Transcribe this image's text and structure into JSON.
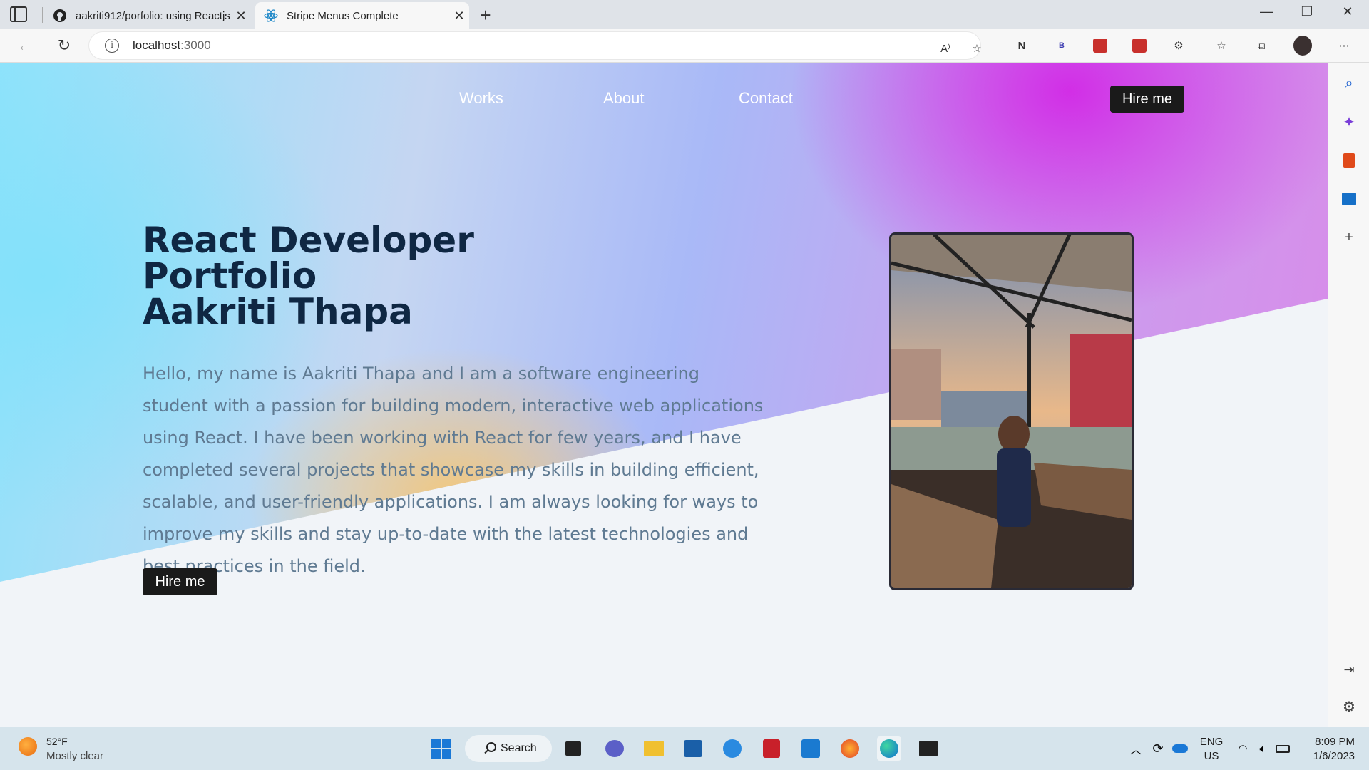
{
  "browser": {
    "tabs": [
      {
        "title": "aakriti912/porfolio: using Reactjs",
        "active": false,
        "icon": "github-icon"
      },
      {
        "title": "Stripe Menus Complete",
        "active": true,
        "icon": "react-icon"
      }
    ],
    "address": {
      "host": "localhost",
      "port": ":3000"
    }
  },
  "page": {
    "nav": {
      "links": [
        "Works",
        "About",
        "Contact"
      ],
      "cta": "Hire me"
    },
    "hero": {
      "title_lines": [
        "React Developer",
        "Portfolio",
        "Aakriti Thapa"
      ],
      "paragraph": "Hello, my name is Aakriti Thapa and I am a software engineering student with a passion for building modern, interactive web applications using React. I have been working with React for few years, and I have completed several projects that showcase my skills in building efficient, scalable, and user-friendly applications. I am always looking for ways to improve my skills and stay up-to-date with the latest technologies and best practices in the field.",
      "cta": "Hire me"
    },
    "colors": {
      "title": "#0f2743",
      "text": "#5f7a92",
      "button": "#1a1a1a",
      "gradient_cyan": "#8fe3fb",
      "gradient_purple": "#d22ee6"
    }
  },
  "taskbar": {
    "weather": {
      "temp": "52°F",
      "desc": "Mostly clear"
    },
    "search_label": "Search",
    "lang": [
      "ENG",
      "US"
    ],
    "time": "8:09 PM",
    "date": "1/6/2023"
  }
}
